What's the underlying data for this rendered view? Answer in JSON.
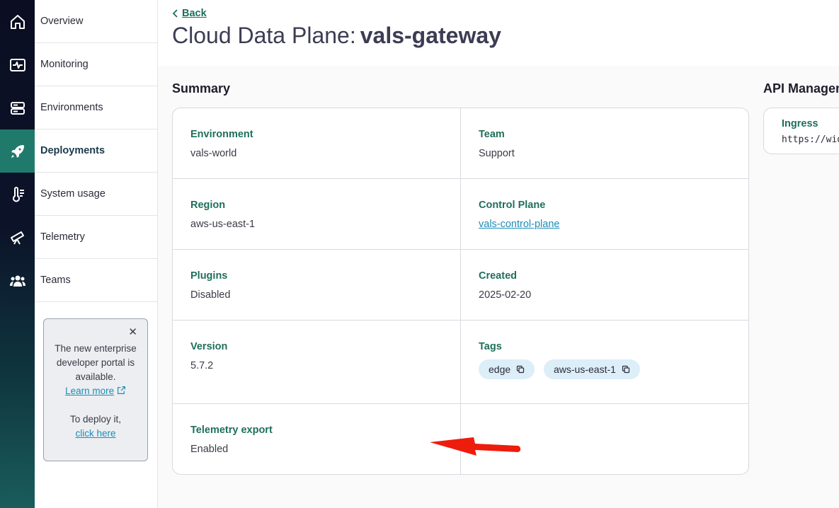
{
  "rail": {
    "icons": [
      "home-icon",
      "monitor-pulse-icon",
      "server-stack-icon",
      "rocket-icon",
      "thermometer-icon",
      "telescope-icon",
      "users-icon"
    ]
  },
  "subnav": {
    "items": [
      {
        "label": "Overview"
      },
      {
        "label": "Monitoring"
      },
      {
        "label": "Environments"
      },
      {
        "label": "Deployments"
      },
      {
        "label": "System usage"
      },
      {
        "label": "Telemetry"
      },
      {
        "label": "Teams"
      }
    ],
    "active_index": 3
  },
  "promo": {
    "line1": "The new enterprise",
    "line2": "developer portal is",
    "line3": "available.",
    "learn_more": "Learn more",
    "deploy_text": "To deploy it,",
    "click_here": "click here"
  },
  "header": {
    "back_label": "Back",
    "title_prefix": "Cloud Data Plane:",
    "title_name": "vals-gateway"
  },
  "summary": {
    "title": "Summary",
    "environment": {
      "label": "Environment",
      "value": "vals-world"
    },
    "team": {
      "label": "Team",
      "value": "Support"
    },
    "region": {
      "label": "Region",
      "value": "aws-us-east-1"
    },
    "control_plane": {
      "label": "Control Plane",
      "value": "vals-control-plane"
    },
    "plugins": {
      "label": "Plugins",
      "value": "Disabled"
    },
    "created": {
      "label": "Created",
      "value": "2025-02-20"
    },
    "version": {
      "label": "Version",
      "value": "5.7.2"
    },
    "tags": {
      "label": "Tags",
      "items": [
        "edge",
        "aws-us-east-1"
      ]
    },
    "telemetry_export": {
      "label": "Telemetry export",
      "value": "Enabled"
    }
  },
  "api_management": {
    "title": "API Managem",
    "ingress_label": "Ingress",
    "ingress_value": "https://wid"
  },
  "colors": {
    "accent_green": "#1f6f5a",
    "link_blue": "#1b8db8",
    "active_rail": "#1f7a6b",
    "annotation_arrow": "#ee1c0c"
  }
}
